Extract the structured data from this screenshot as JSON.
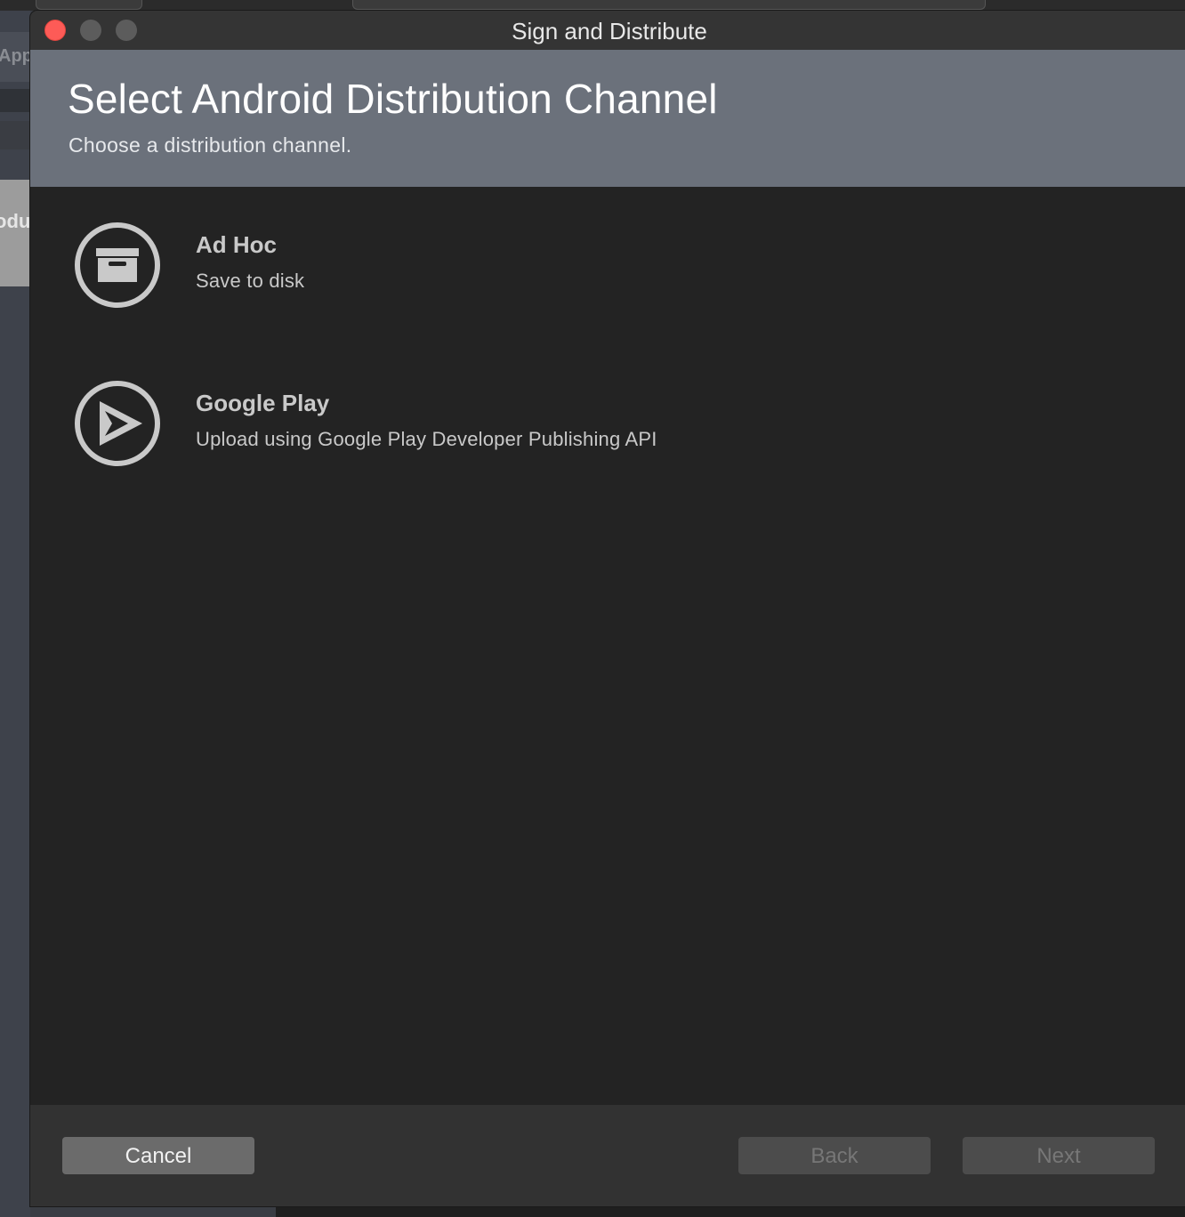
{
  "background": {
    "sidebar_text_1": "App",
    "sidebar_text_2": "odu"
  },
  "window": {
    "title": "Sign and Distribute"
  },
  "header": {
    "title": "Select Android Distribution Channel",
    "subtitle": "Choose a distribution channel."
  },
  "options": [
    {
      "title": "Ad Hoc",
      "description": "Save to disk",
      "icon": "archive-box-icon"
    },
    {
      "title": "Google Play",
      "description": "Upload using Google Play Developer Publishing API",
      "icon": "play-icon"
    }
  ],
  "footer": {
    "cancel_label": "Cancel",
    "back_label": "Back",
    "next_label": "Next"
  },
  "colors": {
    "header_band": "#6b717b",
    "window_bg": "#232323",
    "close_button": "#fd5b57",
    "icon_stroke": "#c9c9c9"
  }
}
